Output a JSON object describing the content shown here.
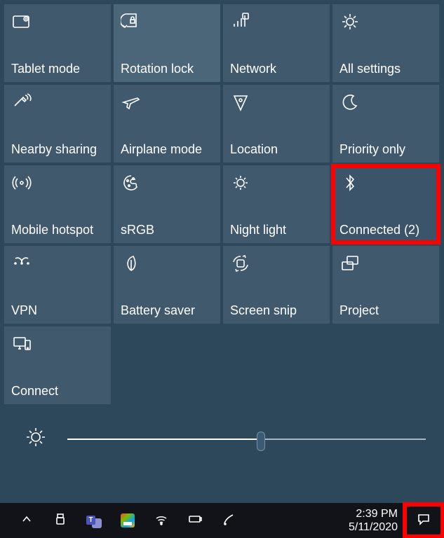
{
  "tiles": [
    {
      "id": "tablet-mode",
      "label": "Tablet mode",
      "icon": "tablet-mode-icon",
      "state": "normal"
    },
    {
      "id": "rotation-lock",
      "label": "Rotation lock",
      "icon": "rotation-lock-icon",
      "state": "active"
    },
    {
      "id": "network",
      "label": "Network",
      "icon": "cellular-icon",
      "state": "normal"
    },
    {
      "id": "all-settings",
      "label": "All settings",
      "icon": "gear-icon",
      "state": "normal"
    },
    {
      "id": "nearby-sharing",
      "label": "Nearby sharing",
      "icon": "nearby-share-icon",
      "state": "normal"
    },
    {
      "id": "airplane-mode",
      "label": "Airplane mode",
      "icon": "airplane-icon",
      "state": "normal"
    },
    {
      "id": "location",
      "label": "Location",
      "icon": "location-icon",
      "state": "normal"
    },
    {
      "id": "priority-only",
      "label": "Priority only",
      "icon": "moon-icon",
      "state": "normal"
    },
    {
      "id": "mobile-hotspot",
      "label": "Mobile hotspot",
      "icon": "hotspot-icon",
      "state": "normal"
    },
    {
      "id": "srgb",
      "label": "sRGB",
      "icon": "palette-icon",
      "state": "normal"
    },
    {
      "id": "night-light",
      "label": "Night light",
      "icon": "night-light-icon",
      "state": "normal"
    },
    {
      "id": "bluetooth",
      "label": "Connected (2)",
      "icon": "bluetooth-icon",
      "state": "highlight"
    },
    {
      "id": "vpn",
      "label": "VPN",
      "icon": "vpn-icon",
      "state": "normal"
    },
    {
      "id": "battery-saver",
      "label": "Battery saver",
      "icon": "leaf-icon",
      "state": "normal"
    },
    {
      "id": "screen-snip",
      "label": "Screen snip",
      "icon": "snip-icon",
      "state": "normal"
    },
    {
      "id": "project",
      "label": "Project",
      "icon": "project-icon",
      "state": "normal"
    },
    {
      "id": "connect",
      "label": "Connect",
      "icon": "connect-icon",
      "state": "normal"
    }
  ],
  "brightness": {
    "percent": 54
  },
  "taskbar": {
    "time": "2:39 PM",
    "date": "5/11/2020",
    "tray_icons": [
      {
        "id": "chevron-up",
        "name": "tray-overflow",
        "icon": "chevron-up-icon"
      },
      {
        "id": "usb",
        "name": "tray-usb",
        "icon": "usb-icon"
      },
      {
        "id": "teams",
        "name": "tray-teams",
        "icon": "teams-icon"
      },
      {
        "id": "powertoys",
        "name": "tray-powertoys",
        "icon": "powertoys-icon"
      },
      {
        "id": "wifi",
        "name": "tray-wifi",
        "icon": "wifi-icon"
      },
      {
        "id": "battery",
        "name": "tray-battery",
        "icon": "battery-icon"
      },
      {
        "id": "pen",
        "name": "tray-pen",
        "icon": "pen-icon"
      }
    ]
  }
}
